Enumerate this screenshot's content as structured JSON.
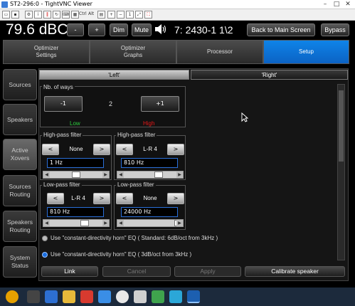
{
  "window": {
    "title": "ST2-296:0 - TightVNC Viewer"
  },
  "toolbar": {
    "ctrl_label": "Ctrl",
    "alt_label": "Alt"
  },
  "header": {
    "level": "79.6 dBC",
    "minus_label": "-",
    "plus_label": "+",
    "dim_label": "Dim",
    "mute_label": "Mute",
    "preset": "7: 2430-1 1\\2",
    "back_label": "Back to Main Screen",
    "bypass_label": "Bypass"
  },
  "tabs": [
    {
      "label": "Optimizer\nSettings"
    },
    {
      "label": "Optimizer\nGraphs"
    },
    {
      "label": "Processor"
    },
    {
      "label": "Setup"
    }
  ],
  "sidebar": [
    {
      "label": "Sources"
    },
    {
      "label": "Speakers"
    },
    {
      "label": "Active\nXovers"
    },
    {
      "label": "Sources\nRouting"
    },
    {
      "label": "Speakers\nRouting"
    },
    {
      "label": "System\nStatus"
    }
  ],
  "subtabs": {
    "left": "'Left'",
    "right": "'Right'"
  },
  "ways": {
    "title": "Nb. of ways",
    "minus_label": "-1",
    "value": "2",
    "plus_label": "+1",
    "low_label": "Low",
    "high_label": "High"
  },
  "low_hp": {
    "title": "High-pass filter",
    "prev": "<",
    "type": "None",
    "next": ">",
    "freq": "1 Hz"
  },
  "high_hp": {
    "title": "High-pass filter",
    "prev": "<",
    "type": "L-R 4",
    "next": ">",
    "freq": "810 Hz"
  },
  "low_lp": {
    "title": "Low-pass filter",
    "prev": "<",
    "type": "L-R 4",
    "next": ">",
    "freq": "810 Hz"
  },
  "high_lp": {
    "title": "Low-pass filter",
    "prev": "<",
    "type": "None",
    "next": ">",
    "freq": "24000 Hz"
  },
  "eq_options": [
    {
      "label": "Use \"constant-directivity horn\" EQ  ( Standard: 6dB/oct from 3kHz )",
      "selected": false
    },
    {
      "label": "Use \"constant-directivity horn\" EQ  ( 3dB/oct from 3kHz )",
      "selected": true
    }
  ],
  "bottom": {
    "link": "Link",
    "cancel": "Cancel",
    "apply": "Apply",
    "calibrate": "Calibrate speaker"
  },
  "colors": {
    "low": "#2ecc40",
    "high": "#e81818",
    "accent": "#0b6fd8"
  }
}
